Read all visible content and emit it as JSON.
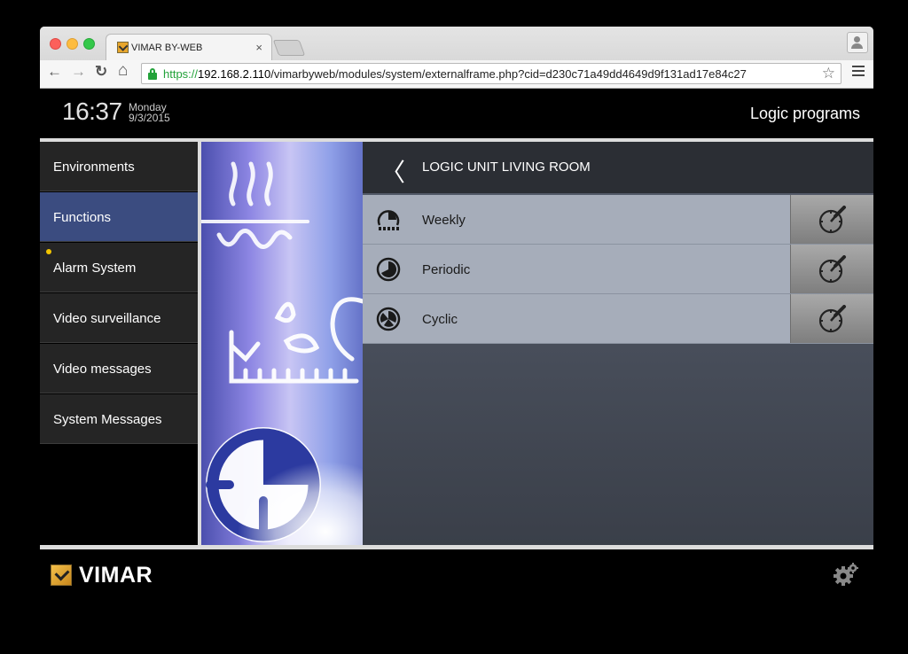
{
  "browser": {
    "tab_title": "VIMAR BY-WEB",
    "tab_close": "×",
    "url_scheme": "https://",
    "url_host": "192.168.2.110",
    "url_path": "/vimarbyweb/modules/system/externalframe.php?cid=d230c71a49dd4649d9f131ad17e84c27",
    "back_icon": "←",
    "forward_icon": "→",
    "reload_icon": "↻",
    "home_icon": "⌂",
    "star_icon": "☆"
  },
  "header": {
    "time": "16:37",
    "weekday": "Monday",
    "date": "9/3/2015",
    "page_title": "Logic programs"
  },
  "sidebar": {
    "items": [
      {
        "label": "Environments"
      },
      {
        "label": "Functions"
      },
      {
        "label": "Alarm System"
      },
      {
        "label": "Video surveillance"
      },
      {
        "label": "Video messages"
      },
      {
        "label": "System Messages"
      }
    ],
    "active_index": 1,
    "alert_item_index": 2
  },
  "content": {
    "back_icon": "〈",
    "title": "LOGIC UNIT LIVING ROOM",
    "programs": [
      {
        "label": "Weekly",
        "icon": "weekly-program-icon"
      },
      {
        "label": "Periodic",
        "icon": "periodic-program-icon"
      },
      {
        "label": "Cyclic",
        "icon": "cyclic-program-icon"
      }
    ]
  },
  "footer": {
    "brand": "VIMAR"
  },
  "colors": {
    "active_nav": "#3b4c80",
    "alert_dot": "#f2c500",
    "row_bg": "#a6adba",
    "secure_green": "#23a23a"
  }
}
